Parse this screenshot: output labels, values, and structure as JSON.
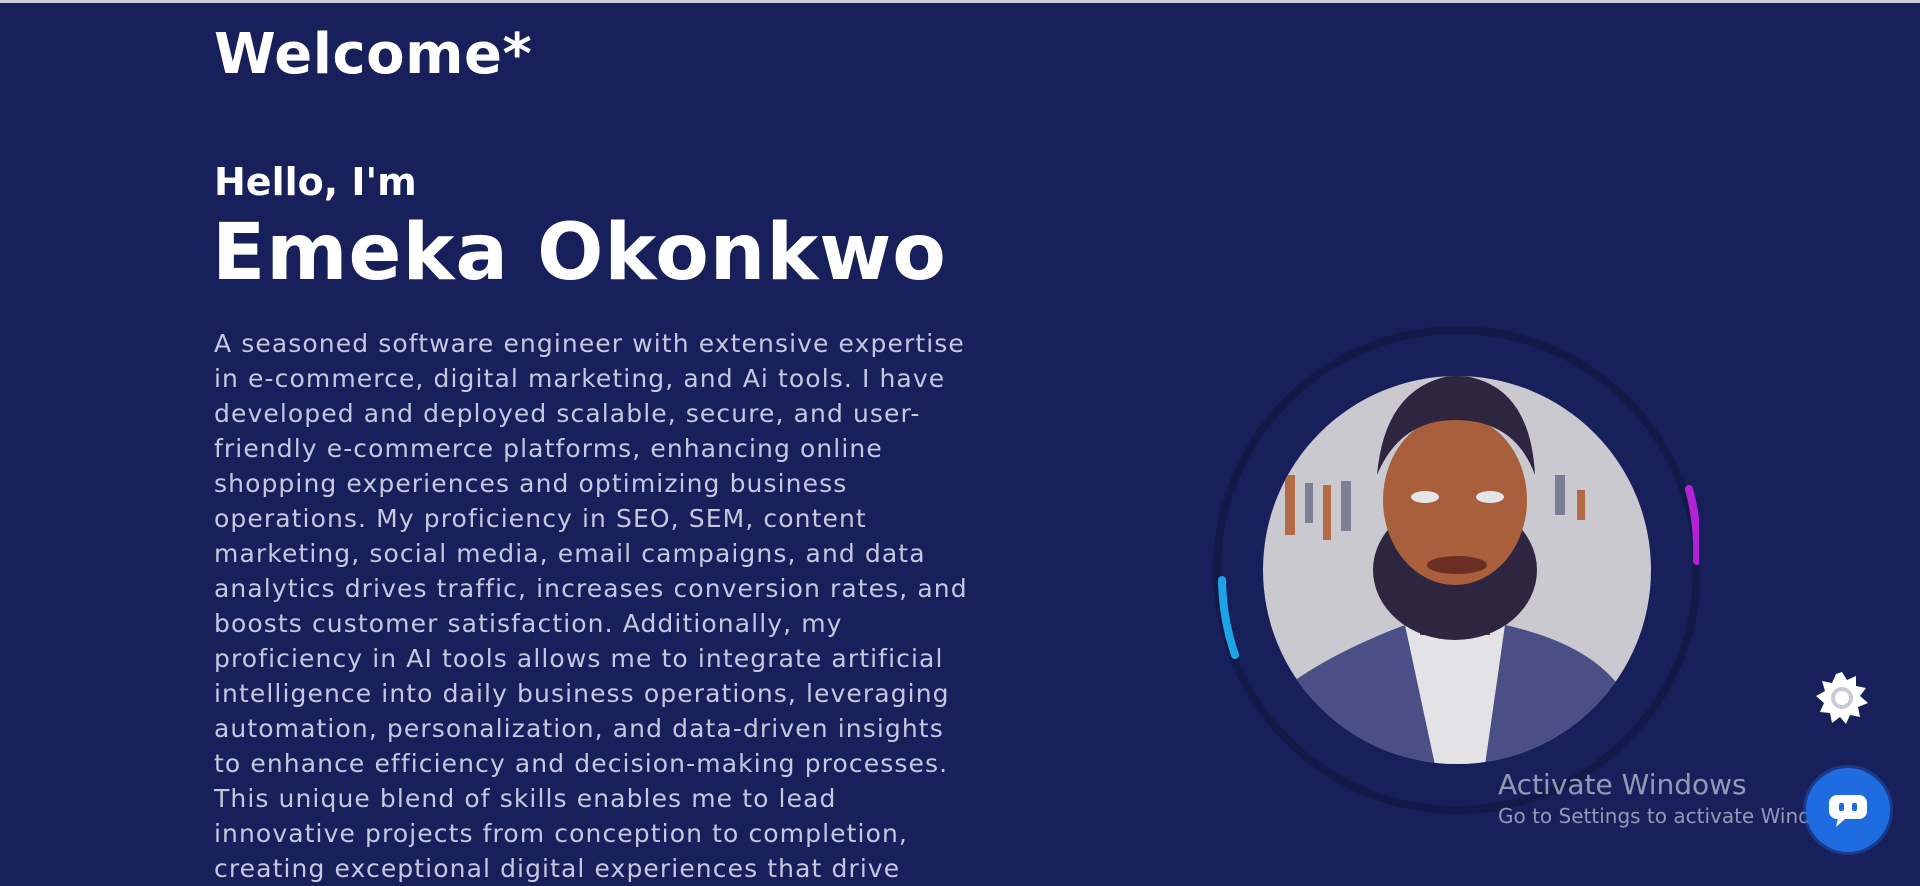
{
  "header": {
    "welcome": "Welcome*"
  },
  "hero": {
    "greeting": "Hello, I'm",
    "name": "Emeka Okonkwo",
    "bio": "A seasoned software engineer with extensive expertise in e-commerce, digital marketing, and Ai tools. I have developed and deployed scalable, secure, and user-friendly e-commerce platforms, enhancing online shopping experiences and optimizing business operations. My proficiency in SEO, SEM, content marketing, social media, email campaigns, and data analytics drives traffic, increases conversion rates, and boosts customer satisfaction. Additionally, my proficiency in AI tools allows me to integrate artificial intelligence into daily business operations, leveraging automation, personalization, and data-driven insights to enhance efficiency and decision-making processes. This unique blend of skills enables me to lead innovative projects from conception to completion, creating exceptional digital experiences that drive"
  },
  "portrait": {
    "icon": "profile-photo"
  },
  "floating": {
    "settings_icon": "gear-icon",
    "chat_icon": "chat-bubble-icon"
  },
  "watermark": {
    "title": "Activate Windows",
    "subtitle": "Go to Settings to activate Windows."
  },
  "colors": {
    "background": "#17205a",
    "ring_blue": "#1fa3e8",
    "ring_purple": "#b323d6",
    "chat_button": "#1f6be0"
  }
}
